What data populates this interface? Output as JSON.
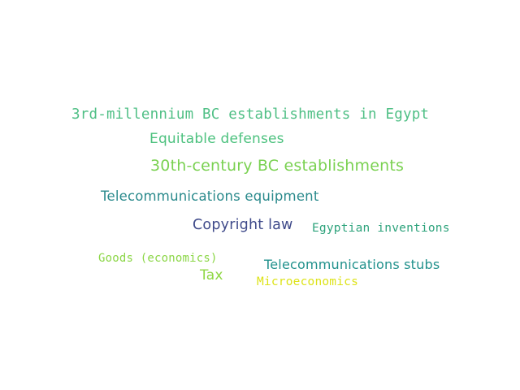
{
  "word_cloud": {
    "words": [
      {
        "text": "3rd-millennium BC establishments in Egypt",
        "color": "#4fbf85"
      },
      {
        "text": "Equitable defenses",
        "color": "#4cc17e"
      },
      {
        "text": "30th-century BC establishments",
        "color": "#7ad151"
      },
      {
        "text": "Telecommunications equipment",
        "color": "#2a8a8c"
      },
      {
        "text": "Copyright law",
        "color": "#3f4a8a"
      },
      {
        "text": "Egyptian inventions",
        "color": "#2ea37c"
      },
      {
        "text": "Goods (economics)",
        "color": "#8bd646"
      },
      {
        "text": "Telecommunications stubs",
        "color": "#21918c"
      },
      {
        "text": "Tax",
        "color": "#8fd744"
      },
      {
        "text": "Microeconomics",
        "color": "#dde318"
      }
    ]
  }
}
